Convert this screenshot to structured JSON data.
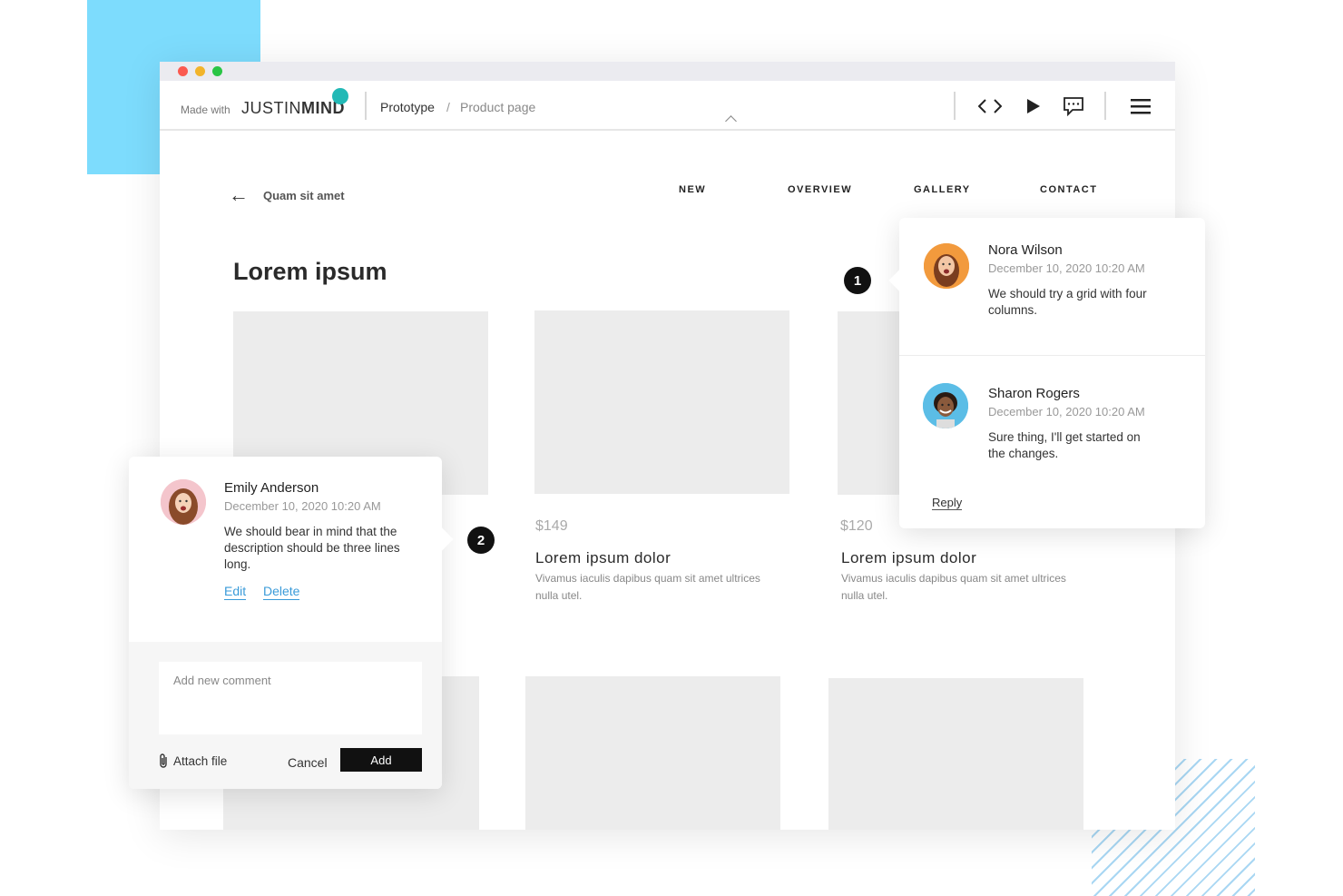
{
  "colors": {
    "accent_blue": "#7ddcfd",
    "logo_dot": "#22b9b6",
    "link_blue": "#3a9bd9",
    "placeholder_gray": "#ececec"
  },
  "toolbar": {
    "made_with": "Made with",
    "logo_light": "JUSTIN",
    "logo_bold": "MIND",
    "breadcrumb_root": "Prototype",
    "breadcrumb_sep": "/",
    "breadcrumb_page": "Product page",
    "icons": [
      "code-icon",
      "play-icon",
      "comment-icon",
      "menu-icon"
    ]
  },
  "page": {
    "back_label": "Quam sit amet",
    "nav": [
      "NEW",
      "OVERVIEW",
      "GALLERY",
      "CONTACT"
    ],
    "title": "Lorem ipsum",
    "products": [
      {
        "price": "$149",
        "title": "Lorem ipsum dolor",
        "desc": "Vivamus iaculis dapibus quam sit amet ultrices nulla utel."
      },
      {
        "price": "$120",
        "title": "Lorem ipsum dolor",
        "desc": "Vivamus iaculis dapibus quam sit amet ultrices nulla utel."
      }
    ]
  },
  "markers": [
    "1",
    "2"
  ],
  "thread_right": {
    "comments": [
      {
        "name": "Nora Wilson",
        "date": "December 10, 2020 10:20 AM",
        "text": "We should try a grid with four columns."
      },
      {
        "name": "Sharon Rogers",
        "date": "December 10, 2020 10:20 AM",
        "text": "Sure thing, I'll get started on the changes."
      }
    ],
    "reply_label": "Reply"
  },
  "thread_left": {
    "comment": {
      "name": "Emily Anderson",
      "date": "December 10, 2020 10:20 AM",
      "text": "We should bear in mind that the description should be three lines long."
    },
    "edit_label": "Edit",
    "delete_label": "Delete",
    "input_placeholder": "Add new comment",
    "attach_label": "Attach file",
    "cancel_label": "Cancel",
    "add_label": "Add"
  }
}
